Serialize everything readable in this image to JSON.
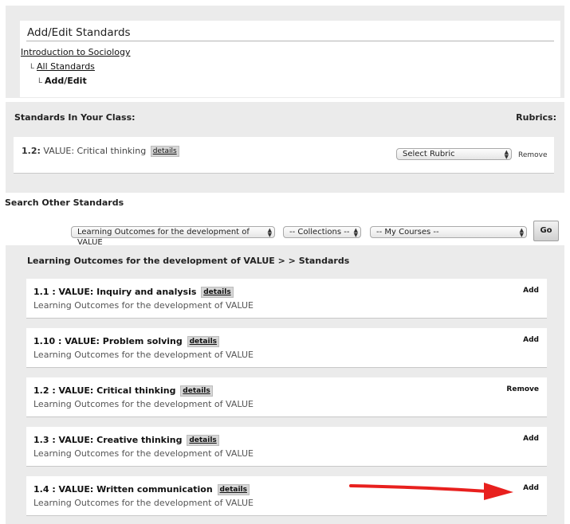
{
  "page": {
    "title": "Add/Edit Standards",
    "breadcrumb": {
      "course": "Introduction to Sociology",
      "indent_glyph": "L",
      "all_standards": "All Standards",
      "current": "Add/Edit"
    }
  },
  "class_standards": {
    "title": "Standards In Your Class:",
    "rubrics_title": "Rubrics:",
    "items": [
      {
        "code": "1.2:",
        "name": "VALUE: Critical thinking",
        "details_label": "details",
        "rubric_select": "Select Rubric",
        "remove_label": "Remove"
      }
    ]
  },
  "search": {
    "title": "Search Other Standards",
    "source_select": "Learning Outcomes for the development of VALUE",
    "collections_select": "-- Collections --",
    "courses_select": "-- My Courses --",
    "go_label": "Go"
  },
  "results": {
    "heading": "Learning Outcomes for the development of VALUE > > Standards",
    "items": [
      {
        "title": "1.1 : VALUE: Inquiry and analysis",
        "details_label": "details",
        "subtitle": "Learning Outcomes for the development of VALUE",
        "action": "Add"
      },
      {
        "title": "1.10 : VALUE: Problem solving",
        "details_label": "details",
        "subtitle": "Learning Outcomes for the development of VALUE",
        "action": "Add"
      },
      {
        "title": "1.2 : VALUE: Critical thinking",
        "details_label": "details",
        "subtitle": "Learning Outcomes for the development of VALUE",
        "action": "Remove"
      },
      {
        "title": "1.3 : VALUE: Creative thinking",
        "details_label": "details",
        "subtitle": "Learning Outcomes for the development of VALUE",
        "action": "Add"
      },
      {
        "title": "1.4 : VALUE: Written communication",
        "details_label": "details",
        "subtitle": "Learning Outcomes for the development of VALUE",
        "action": "Add"
      }
    ]
  },
  "annotation": {
    "arrow_color": "#e8201e",
    "arrow_icon": "red-arrow-icon"
  }
}
